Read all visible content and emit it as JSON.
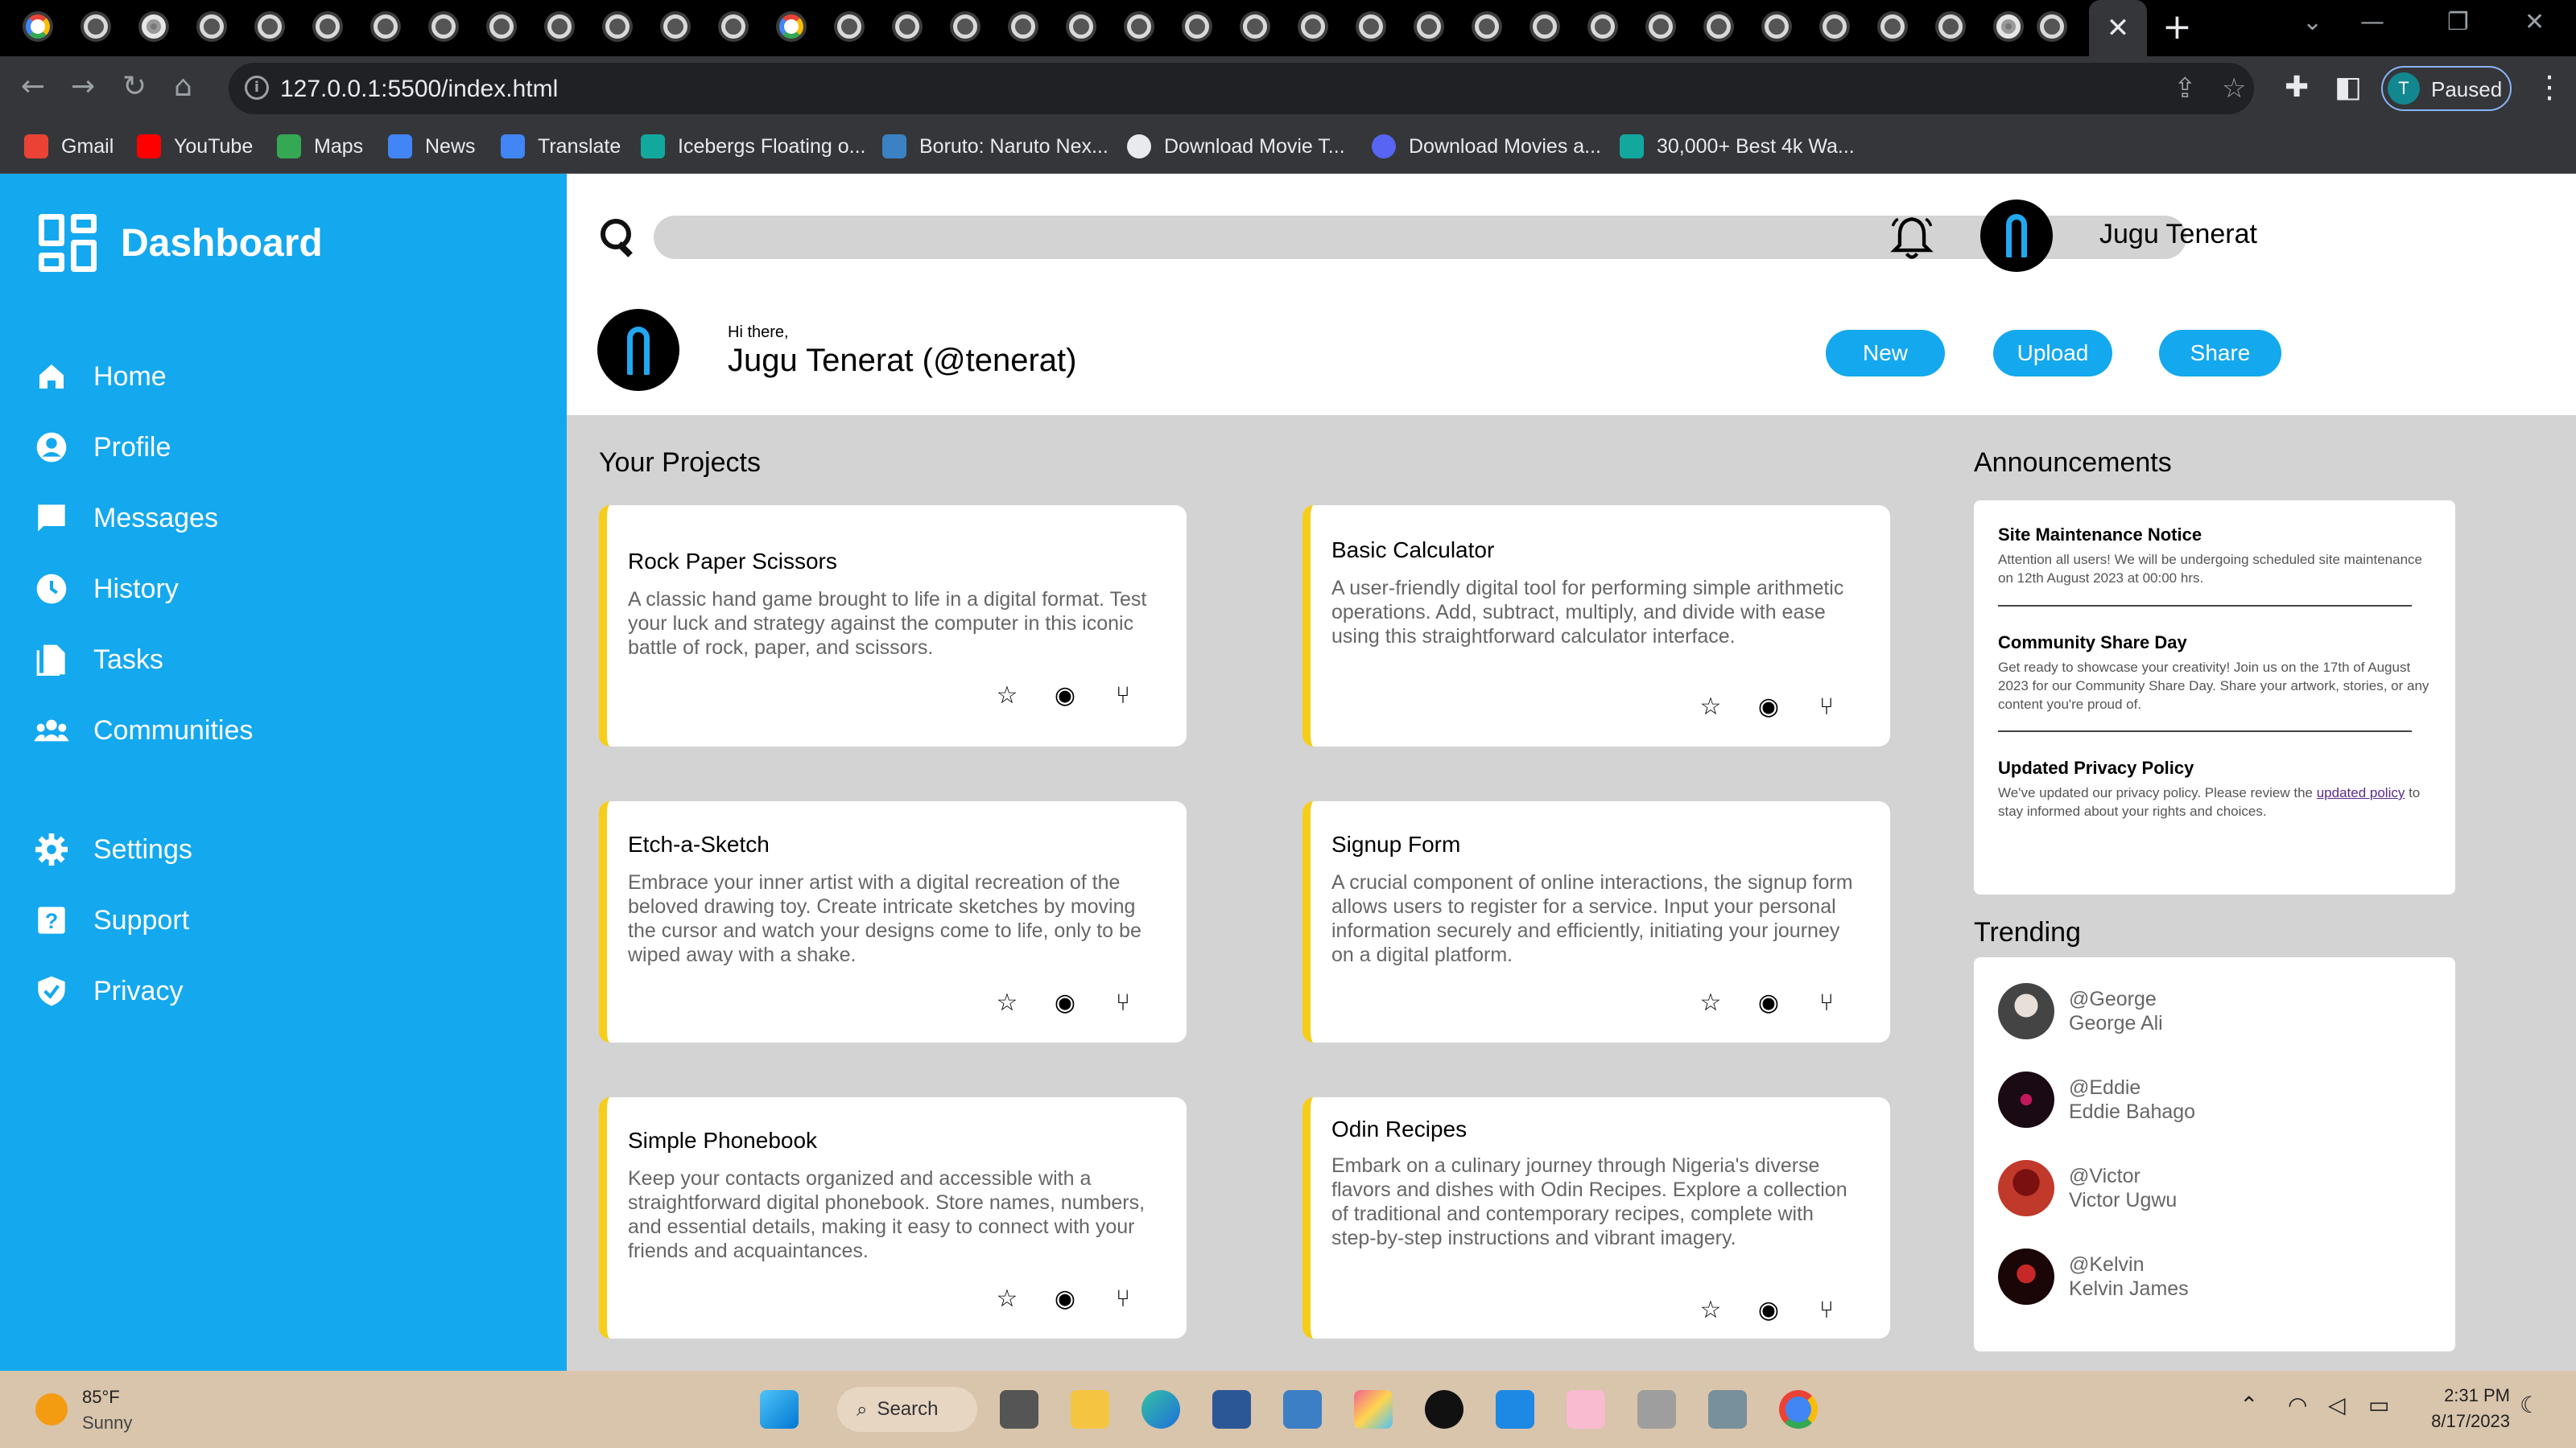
{
  "browser": {
    "url": "127.0.0.1:5500/index.html",
    "profile_initial": "T",
    "profile_status": "Paused",
    "bookmarks": [
      {
        "label": "Gmail",
        "icon": "gmail-icon",
        "color": "#ea4335"
      },
      {
        "label": "YouTube",
        "icon": "youtube-icon",
        "color": "#ff0000"
      },
      {
        "label": "Maps",
        "icon": "maps-icon",
        "color": "#34a853"
      },
      {
        "label": "News",
        "icon": "news-icon",
        "color": "#4285f4"
      },
      {
        "label": "Translate",
        "icon": "translate-icon",
        "color": "#4285f4"
      },
      {
        "label": "Icebergs Floating o...",
        "icon": "image-site-icon",
        "color": "#13a89e"
      },
      {
        "label": "Boruto: Naruto Nex...",
        "icon": "anime-site-icon",
        "color": "#3b82c4"
      },
      {
        "label": "Download Movie T...",
        "icon": "globe-icon",
        "color": "#e8eaed"
      },
      {
        "label": "Download Movies a...",
        "icon": "movie-site-icon",
        "color": "#5865f2"
      },
      {
        "label": "30,000+ Best 4k Wa...",
        "icon": "image-site-icon",
        "color": "#13a89e"
      }
    ]
  },
  "sidebar": {
    "title": "Dashboard",
    "items": [
      {
        "label": "Home",
        "icon": "home-icon"
      },
      {
        "label": "Profile",
        "icon": "profile-icon"
      },
      {
        "label": "Messages",
        "icon": "messages-icon"
      },
      {
        "label": "History",
        "icon": "history-icon"
      },
      {
        "label": "Tasks",
        "icon": "tasks-icon"
      },
      {
        "label": "Communities",
        "icon": "communities-icon"
      },
      {
        "label": "Settings",
        "icon": "settings-icon"
      },
      {
        "label": "Support",
        "icon": "support-icon"
      },
      {
        "label": "Privacy",
        "icon": "privacy-icon"
      }
    ]
  },
  "header": {
    "user_name": "Jugu Tenerat",
    "greeting": "Hi there,",
    "full_name": "Jugu Tenerat (@tenerat)",
    "buttons": [
      "New",
      "Upload",
      "Share"
    ]
  },
  "projects": {
    "title": "Your Projects",
    "items": [
      {
        "title": "Rock Paper Scissors",
        "description": "A classic hand game brought to life in a digital format. Test your luck and strategy against the computer in this iconic battle of rock, paper, and scissors."
      },
      {
        "title": "Basic Calculator",
        "description": "A user-friendly digital tool for performing simple arithmetic operations. Add, subtract, multiply, and divide with ease using this straightforward calculator interface."
      },
      {
        "title": "Etch-a-Sketch",
        "description": "Embrace your inner artist with a digital recreation of the beloved drawing toy. Create intricate sketches by moving the cursor and watch your designs come to life, only to be wiped away with a shake."
      },
      {
        "title": "Signup Form",
        "description": "A crucial component of online interactions, the signup form allows users to register for a service. Input your personal information securely and efficiently, initiating your journey on a digital platform."
      },
      {
        "title": "Simple Phonebook",
        "description": "Keep your contacts organized and accessible with a straightforward digital phonebook. Store names, numbers, and essential details, making it easy to connect with your friends and acquaintances."
      },
      {
        "title": "Odin Recipes",
        "description": "Embark on a culinary journey through Nigeria's diverse flavors and dishes with Odin Recipes. Explore a collection of traditional and contemporary recipes, complete with step-by-step instructions and vibrant imagery."
      }
    ]
  },
  "announcements": {
    "title": "Announcements",
    "items": [
      {
        "title": "Site Maintenance Notice",
        "text": "Attention all users! We will be undergoing scheduled site maintenance on 12th August 2023 at 00:00 hrs."
      },
      {
        "title": "Community Share Day",
        "text": "Get ready to showcase your creativity! Join us on the 17th of August 2023 for our Community Share Day. Share your artwork, stories, or any content you're proud of."
      },
      {
        "title": "Updated Privacy Policy",
        "text_before": "We've updated our privacy policy. Please review the ",
        "link": "updated policy",
        "text_after": " to stay informed about your rights and choices."
      }
    ]
  },
  "trending": {
    "title": "Trending",
    "items": [
      {
        "handle": "@George",
        "name": "George Ali",
        "color": "#444444"
      },
      {
        "handle": "@Eddie",
        "name": "Eddie Bahago",
        "color": "#1a0a14"
      },
      {
        "handle": "@Victor",
        "name": "Victor Ugwu",
        "color": "#c0392b"
      },
      {
        "handle": "@Kelvin",
        "name": "Kelvin James",
        "color": "#5a0d0d"
      }
    ]
  },
  "taskbar": {
    "temperature": "85°F",
    "condition": "Sunny",
    "search_label": "Search",
    "time": "2:31 PM",
    "date": "8/17/2023"
  },
  "colors": {
    "sidebar": "#14a8ee",
    "accent": "#14a8ee",
    "card_stripe": "#f7cd1a",
    "page_bg": "#d3d3d3"
  }
}
